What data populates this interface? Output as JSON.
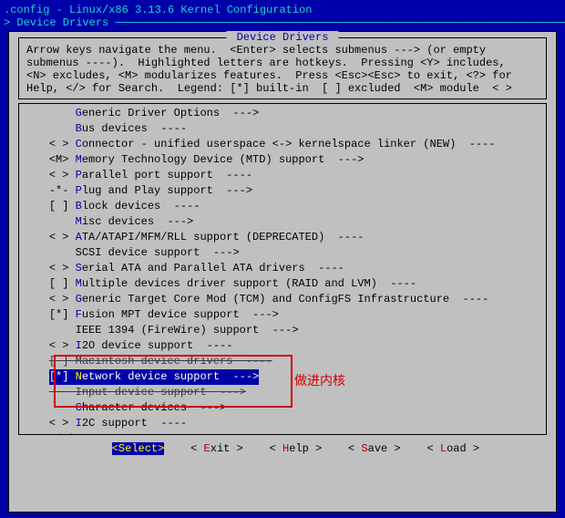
{
  "title": ".config - Linux/x86 3.13.6 Kernel Configuration",
  "breadcrumb": "> Device Drivers ",
  "box_title": " Device Drivers ",
  "help": "Arrow keys navigate the menu.  <Enter> selects submenus ---> (or empty\nsubmenus ----).  Highlighted letters are hotkeys.  Pressing <Y> includes,\n<N> excludes, <M> modularizes features.  Press <Esc><Esc> to exit, <?> for\nHelp, </> for Search.  Legend: [*] built-in  [ ] excluded  <M> module  < >",
  "items": [
    {
      "prefix": "    ",
      "hot": "G",
      "rest": "eneric Driver Options  --->"
    },
    {
      "prefix": "    ",
      "hot": "B",
      "rest": "us devices  ----"
    },
    {
      "prefix": "< > ",
      "hot": "C",
      "rest": "onnector - unified userspace <-> kernelspace linker (NEW)  ----"
    },
    {
      "prefix": "<M> ",
      "hot": "M",
      "rest": "emory Technology Device (MTD) support  --->"
    },
    {
      "prefix": "< > ",
      "hot": "P",
      "rest": "arallel port support  ----"
    },
    {
      "prefix": "-*- ",
      "hot": "P",
      "rest": "lug and Play support  --->"
    },
    {
      "prefix": "[ ] ",
      "hot": "B",
      "rest": "lock devices  ----"
    },
    {
      "prefix": "    ",
      "hot": "M",
      "rest": "isc devices  --->"
    },
    {
      "prefix": "< > ",
      "hot": "A",
      "rest": "TA/ATAPI/MFM/RLL support (DEPRECATED)  ----"
    },
    {
      "prefix": "    ",
      "hot": "",
      "rest": "SCSI device support  --->"
    },
    {
      "prefix": "< > ",
      "hot": "S",
      "rest": "erial ATA and Parallel ATA drivers  ----"
    },
    {
      "prefix": "[ ] ",
      "hot": "M",
      "rest": "ultiple devices driver support (RAID and LVM)  ----"
    },
    {
      "prefix": "< > ",
      "hot": "G",
      "rest": "eneric Target Core Mod (TCM) and ConfigFS Infrastructure  ----"
    },
    {
      "prefix": "[*] ",
      "hot": "F",
      "rest": "usion MPT device support  --->"
    },
    {
      "prefix": "    ",
      "hot": "",
      "rest": "IEEE 1394 (FireWire) support  --->"
    },
    {
      "prefix": "< > ",
      "hot": "I",
      "rest": "2O device support  ----"
    },
    {
      "prefix": "[ ] ",
      "hot": "",
      "rest": "Macintosh device drivers  ----",
      "strike": true
    },
    {
      "prefix": "[*] ",
      "hot": "N",
      "rest": "etwork device support  --->",
      "selected": true
    },
    {
      "prefix": "    ",
      "hot": "",
      "rest": "Input device support  --->",
      "strike": true
    },
    {
      "prefix": "    ",
      "hot": "C",
      "rest": "haracter devices  --->"
    },
    {
      "prefix": "< > ",
      "hot": "I",
      "rest": "2C support  ----"
    }
  ],
  "scroll_indicator": "    v(+)",
  "annotation": "做进内核",
  "buttons": {
    "select": "<Select>",
    "exit_pre": "< ",
    "exit_hot": "E",
    "exit_post": "xit >",
    "help_pre": "< ",
    "help_hot": "H",
    "help_post": "elp >",
    "save_pre": "< ",
    "save_hot": "S",
    "save_post": "ave >",
    "load_pre": "< ",
    "load_hot": "L",
    "load_post": "oad >"
  }
}
